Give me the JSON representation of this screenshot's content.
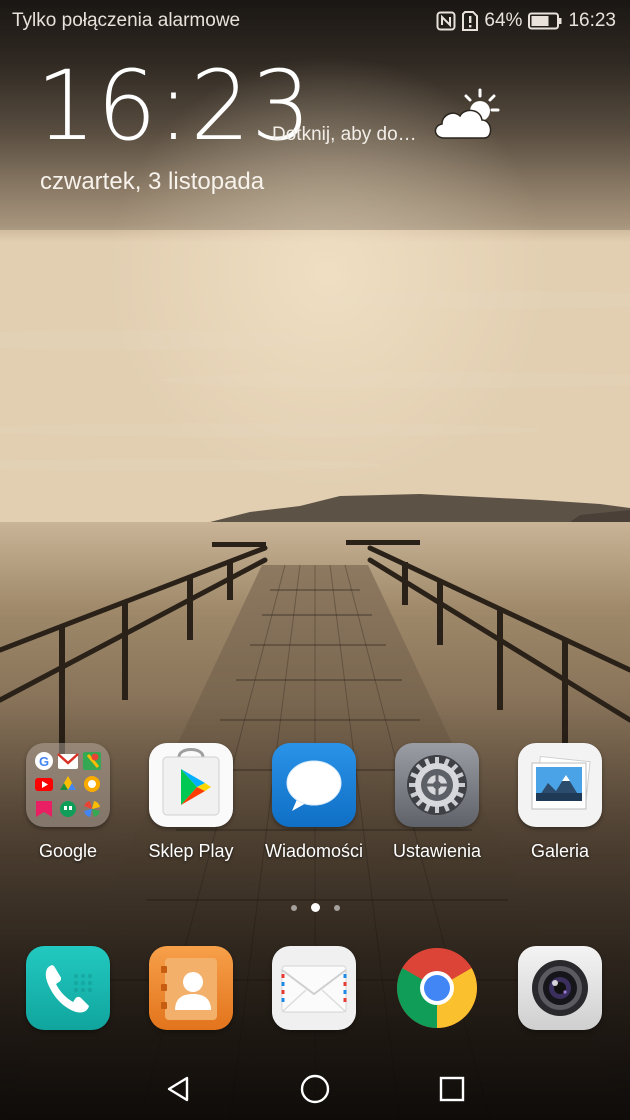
{
  "status_bar": {
    "carrier_text": "Tylko połączenia alarmowe",
    "battery": "64%",
    "time": "16:23",
    "icons": [
      "nfc-icon",
      "sim-alert-icon",
      "battery-icon"
    ]
  },
  "clock_widget": {
    "time": "16:23",
    "weather_hint": "Dotknij, aby do…",
    "weather_icon": "partly-cloudy-icon",
    "date": "czwartek, 3 listopada"
  },
  "apps": [
    {
      "label": "Google",
      "icon": "google-folder-icon"
    },
    {
      "label": "Sklep Play",
      "icon": "play-store-icon"
    },
    {
      "label": "Wiadomości",
      "icon": "messages-icon"
    },
    {
      "label": "Ustawienia",
      "icon": "settings-icon"
    },
    {
      "label": "Galeria",
      "icon": "gallery-icon"
    }
  ],
  "page_indicator": {
    "pages": 3,
    "current": 2
  },
  "dock": [
    {
      "icon": "phone-icon"
    },
    {
      "icon": "contacts-icon"
    },
    {
      "icon": "email-icon"
    },
    {
      "icon": "chrome-icon"
    },
    {
      "icon": "camera-icon"
    }
  ],
  "nav_bar": {
    "icons": [
      "back-icon",
      "home-icon",
      "recents-icon"
    ]
  },
  "colors": {
    "sky_top": "#2a2520",
    "horizon": "#d8c3a4",
    "water": "#8f7a62",
    "pier": "#5b4a39",
    "messages_blue": "#1a7fd4",
    "phone_teal": "#18b8b0",
    "contacts_orange": "#f08a2c"
  }
}
